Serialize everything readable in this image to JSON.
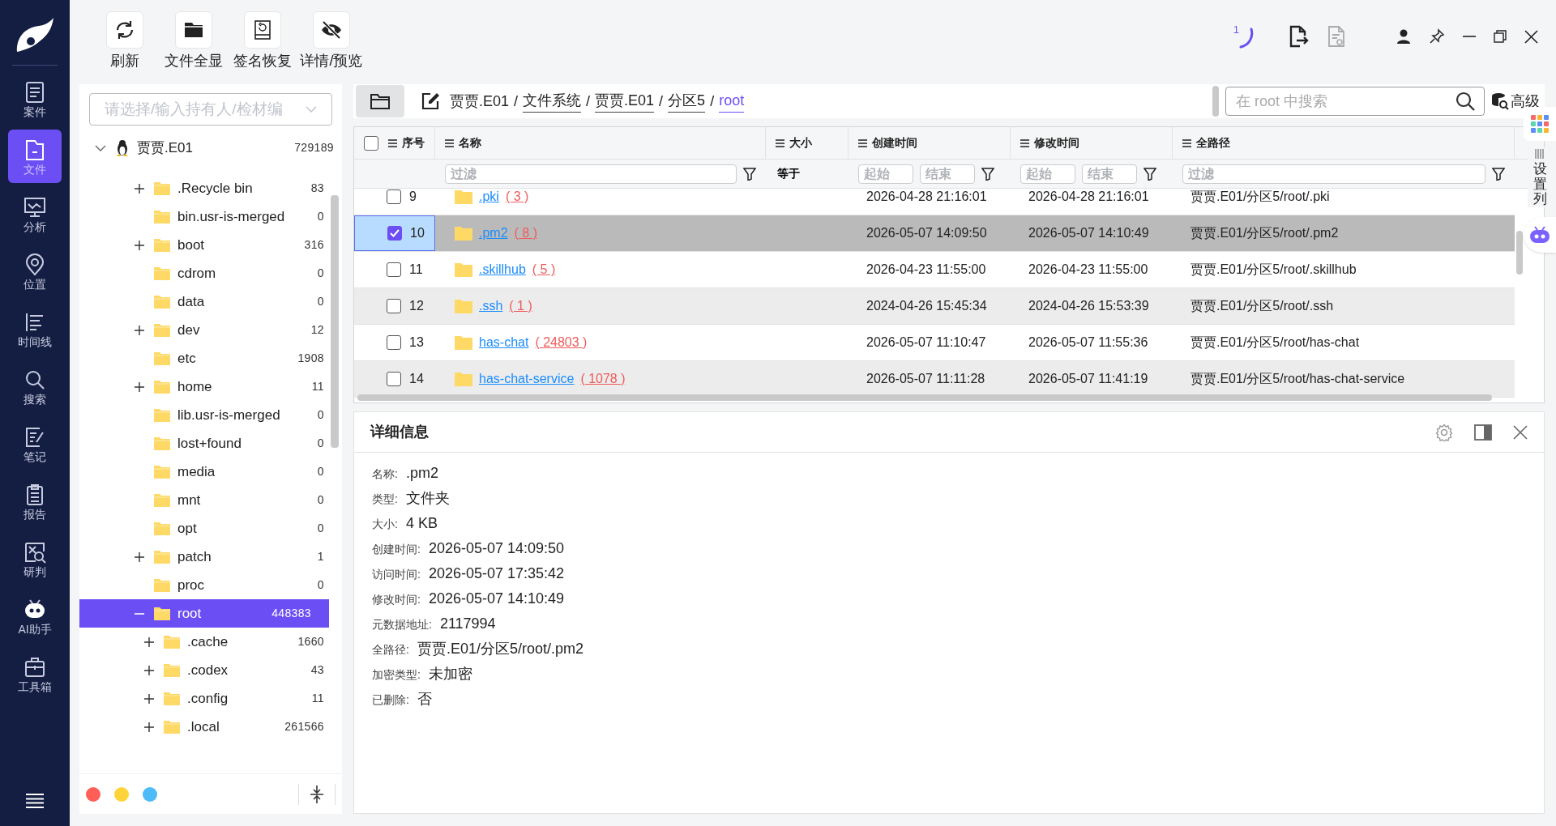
{
  "nav": {
    "items": [
      {
        "label": "案件",
        "selected": false
      },
      {
        "label": "文件",
        "selected": true
      },
      {
        "label": "分析",
        "selected": false
      },
      {
        "label": "位置",
        "selected": false
      },
      {
        "label": "时间线",
        "selected": false
      },
      {
        "label": "搜索",
        "selected": false
      },
      {
        "label": "笔记",
        "selected": false
      },
      {
        "label": "报告",
        "selected": false
      },
      {
        "label": "研判",
        "selected": false
      },
      {
        "label": "AI助手",
        "selected": false
      },
      {
        "label": "工具箱",
        "selected": false
      }
    ]
  },
  "toolbar": {
    "buttons": [
      {
        "label": "刷新"
      },
      {
        "label": "文件全显"
      },
      {
        "label": "签名恢复"
      },
      {
        "label": "详情/预览"
      }
    ]
  },
  "title_bar": {
    "task_count": "1"
  },
  "tree": {
    "selector": {
      "placeholder": "请选择/输入持有人/检材编"
    },
    "nodes": [
      {
        "label": "贾贾.E01",
        "count": "729189",
        "expandable": true,
        "expanded": true,
        "selected": false,
        "children": [
          {
            "label": ".Recycle bin",
            "count": "83",
            "expandable": true,
            "expanded": false,
            "selected": false
          },
          {
            "label": "bin.usr-is-merged",
            "count": "0",
            "expandable": false,
            "expanded": false,
            "selected": false
          },
          {
            "label": "boot",
            "count": "316",
            "expandable": true,
            "expanded": false,
            "selected": false
          },
          {
            "label": "cdrom",
            "count": "0",
            "expandable": false,
            "expanded": false,
            "selected": false
          },
          {
            "label": "data",
            "count": "0",
            "expandable": false,
            "expanded": false,
            "selected": false
          },
          {
            "label": "dev",
            "count": "12",
            "expandable": true,
            "expanded": false,
            "selected": false
          },
          {
            "label": "etc",
            "count": "1908",
            "expandable": false,
            "expanded": false,
            "selected": false
          },
          {
            "label": "home",
            "count": "11",
            "expandable": true,
            "expanded": false,
            "selected": false
          },
          {
            "label": "lib.usr-is-merged",
            "count": "0",
            "expandable": false,
            "expanded": false,
            "selected": false
          },
          {
            "label": "lost+found",
            "count": "0",
            "expandable": false,
            "expanded": false,
            "selected": false
          },
          {
            "label": "media",
            "count": "0",
            "expandable": false,
            "expanded": false,
            "selected": false
          },
          {
            "label": "mnt",
            "count": "0",
            "expandable": false,
            "expanded": false,
            "selected": false
          },
          {
            "label": "opt",
            "count": "0",
            "expandable": false,
            "expanded": false,
            "selected": false
          },
          {
            "label": "patch",
            "count": "1",
            "expandable": true,
            "expanded": false,
            "selected": false
          },
          {
            "label": "proc",
            "count": "0",
            "expandable": false,
            "expanded": false,
            "selected": false
          },
          {
            "label": "root",
            "count": "448383",
            "expandable": true,
            "expanded": true,
            "selected": true,
            "children": [
              {
                "label": ".cache",
                "count": "1660",
                "expandable": true,
                "expanded": false,
                "selected": false
              },
              {
                "label": ".codex",
                "count": "43",
                "expandable": true,
                "expanded": false,
                "selected": false
              },
              {
                "label": ".config",
                "count": "11",
                "expandable": true,
                "expanded": false,
                "selected": false
              },
              {
                "label": ".local",
                "count": "261566",
                "expandable": true,
                "expanded": false,
                "selected": false
              }
            ]
          }
        ]
      }
    ],
    "tags": [
      {
        "color": "#ff5f57"
      },
      {
        "color": "#ffd43b"
      },
      {
        "color": "#4dbbf7"
      }
    ]
  },
  "breadcrumb_separator": "/",
  "breadcrumb": [
    {
      "label": "贾贾.E01",
      "selected": false
    },
    {
      "label": "文件系统",
      "selected": false
    },
    {
      "label": "贾贾.E01",
      "selected": false
    },
    {
      "label": "分区5",
      "selected": false
    },
    {
      "label": "root",
      "selected": true
    }
  ],
  "search": {
    "placeholder": "在 root 中搜索"
  },
  "advanced_button": "高级",
  "table": {
    "select_all_checked": false,
    "columns": [
      {
        "label": "序号",
        "filter": {
          "kind": "none"
        }
      },
      {
        "label": "名称",
        "filter": {
          "kind": "text",
          "placeholder": "过滤"
        }
      },
      {
        "label": "大小",
        "filter": {
          "kind": "label",
          "text": "等于"
        }
      },
      {
        "label": "创建时间",
        "filter": {
          "kind": "range",
          "fields": [
            {
              "placeholder": "起始"
            },
            {
              "placeholder": "结束"
            }
          ]
        }
      },
      {
        "label": "修改时间",
        "filter": {
          "kind": "range",
          "fields": [
            {
              "placeholder": "起始"
            },
            {
              "placeholder": "结束"
            }
          ]
        }
      },
      {
        "label": "全路径",
        "filter": {
          "kind": "text",
          "placeholder": "过滤"
        }
      }
    ],
    "rows": [
      {
        "index": "9",
        "checked": false,
        "selected": false,
        "name": ".pki",
        "count": "( 3 )",
        "created": "2026-04-28 21:16:01",
        "modified": "2026-04-28 21:16:01",
        "path": "贾贾.E01/分区5/root/.pki"
      },
      {
        "index": "10",
        "checked": true,
        "selected": true,
        "name": ".pm2",
        "count": "( 8 )",
        "created": "2026-05-07 14:09:50",
        "modified": "2026-05-07 14:10:49",
        "path": "贾贾.E01/分区5/root/.pm2"
      },
      {
        "index": "11",
        "checked": false,
        "selected": false,
        "name": ".skillhub",
        "count": "( 5 )",
        "created": "2026-04-23 11:55:00",
        "modified": "2026-04-23 11:55:00",
        "path": "贾贾.E01/分区5/root/.skillhub"
      },
      {
        "index": "12",
        "checked": false,
        "selected": false,
        "name": ".ssh",
        "count": "( 1 )",
        "created": "2024-04-26 15:45:34",
        "modified": "2024-04-26 15:53:39",
        "path": "贾贾.E01/分区5/root/.ssh"
      },
      {
        "index": "13",
        "checked": false,
        "selected": false,
        "name": "has-chat",
        "count": "( 24803 )",
        "created": "2026-05-07 11:10:47",
        "modified": "2026-05-07 11:55:36",
        "path": "贾贾.E01/分区5/root/has-chat"
      },
      {
        "index": "14",
        "checked": false,
        "selected": false,
        "name": "has-chat-service",
        "count": "( 1078 )",
        "created": "2026-05-07 11:11:28",
        "modified": "2026-05-07 11:41:19",
        "path": "贾贾.E01/分区5/root/has-chat-service"
      }
    ]
  },
  "details": {
    "title": "详细信息",
    "fields": [
      {
        "label": "名称:",
        "value": ".pm2"
      },
      {
        "label": "类型:",
        "value": "文件夹"
      },
      {
        "label": "大小:",
        "value": "4 KB"
      },
      {
        "label": "创建时间:",
        "value": "2026-05-07 14:09:50"
      },
      {
        "label": "访问时间:",
        "value": "2026-05-07 17:35:42"
      },
      {
        "label": "修改时间:",
        "value": "2026-05-07 14:10:49"
      },
      {
        "label": "元数据地址:",
        "value": "2117994"
      },
      {
        "label": "全路径:",
        "value": "贾贾.E01/分区5/root/.pm2"
      },
      {
        "label": "加密类型:",
        "value": "未加密"
      },
      {
        "label": "已删除:",
        "value": "否"
      }
    ]
  },
  "side_tab": {
    "label": "设置列"
  }
}
